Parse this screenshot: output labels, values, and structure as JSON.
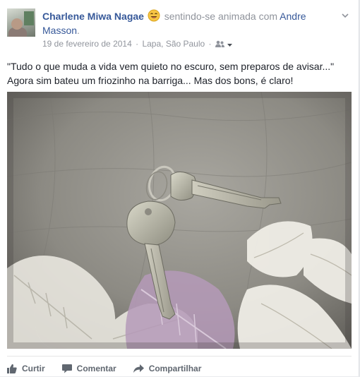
{
  "post": {
    "author": "Charlene Miwa Nagae",
    "feeling_text": "sentindo-se animada com",
    "tagged_person": "Andre Masson",
    "tagged_suffix": ".",
    "date": "19 de fevereiro de 2014",
    "separator": "·",
    "location": "Lapa, São Paulo",
    "text_line1": "\"Tudo o que muda a vida vem quieto no escuro, sem preparos de avisar...\"",
    "text_line2": "Agora sim bateu um friozinho na barriga... Mas dos bons, é claro!"
  },
  "actions": {
    "like": "Curtir",
    "comment": "Comentar",
    "share": "Compartilhar"
  },
  "icons": {
    "feeling": "smiley-face-icon",
    "audience": "friends-icon",
    "menu": "chevron-down-icon",
    "like": "thumbs-up-icon",
    "comment": "speech-bubble-icon",
    "share": "share-arrow-icon"
  },
  "colors": {
    "link": "#365899",
    "secondary_text": "#90949c",
    "body_text": "#1d2129",
    "action_text": "#606770"
  }
}
